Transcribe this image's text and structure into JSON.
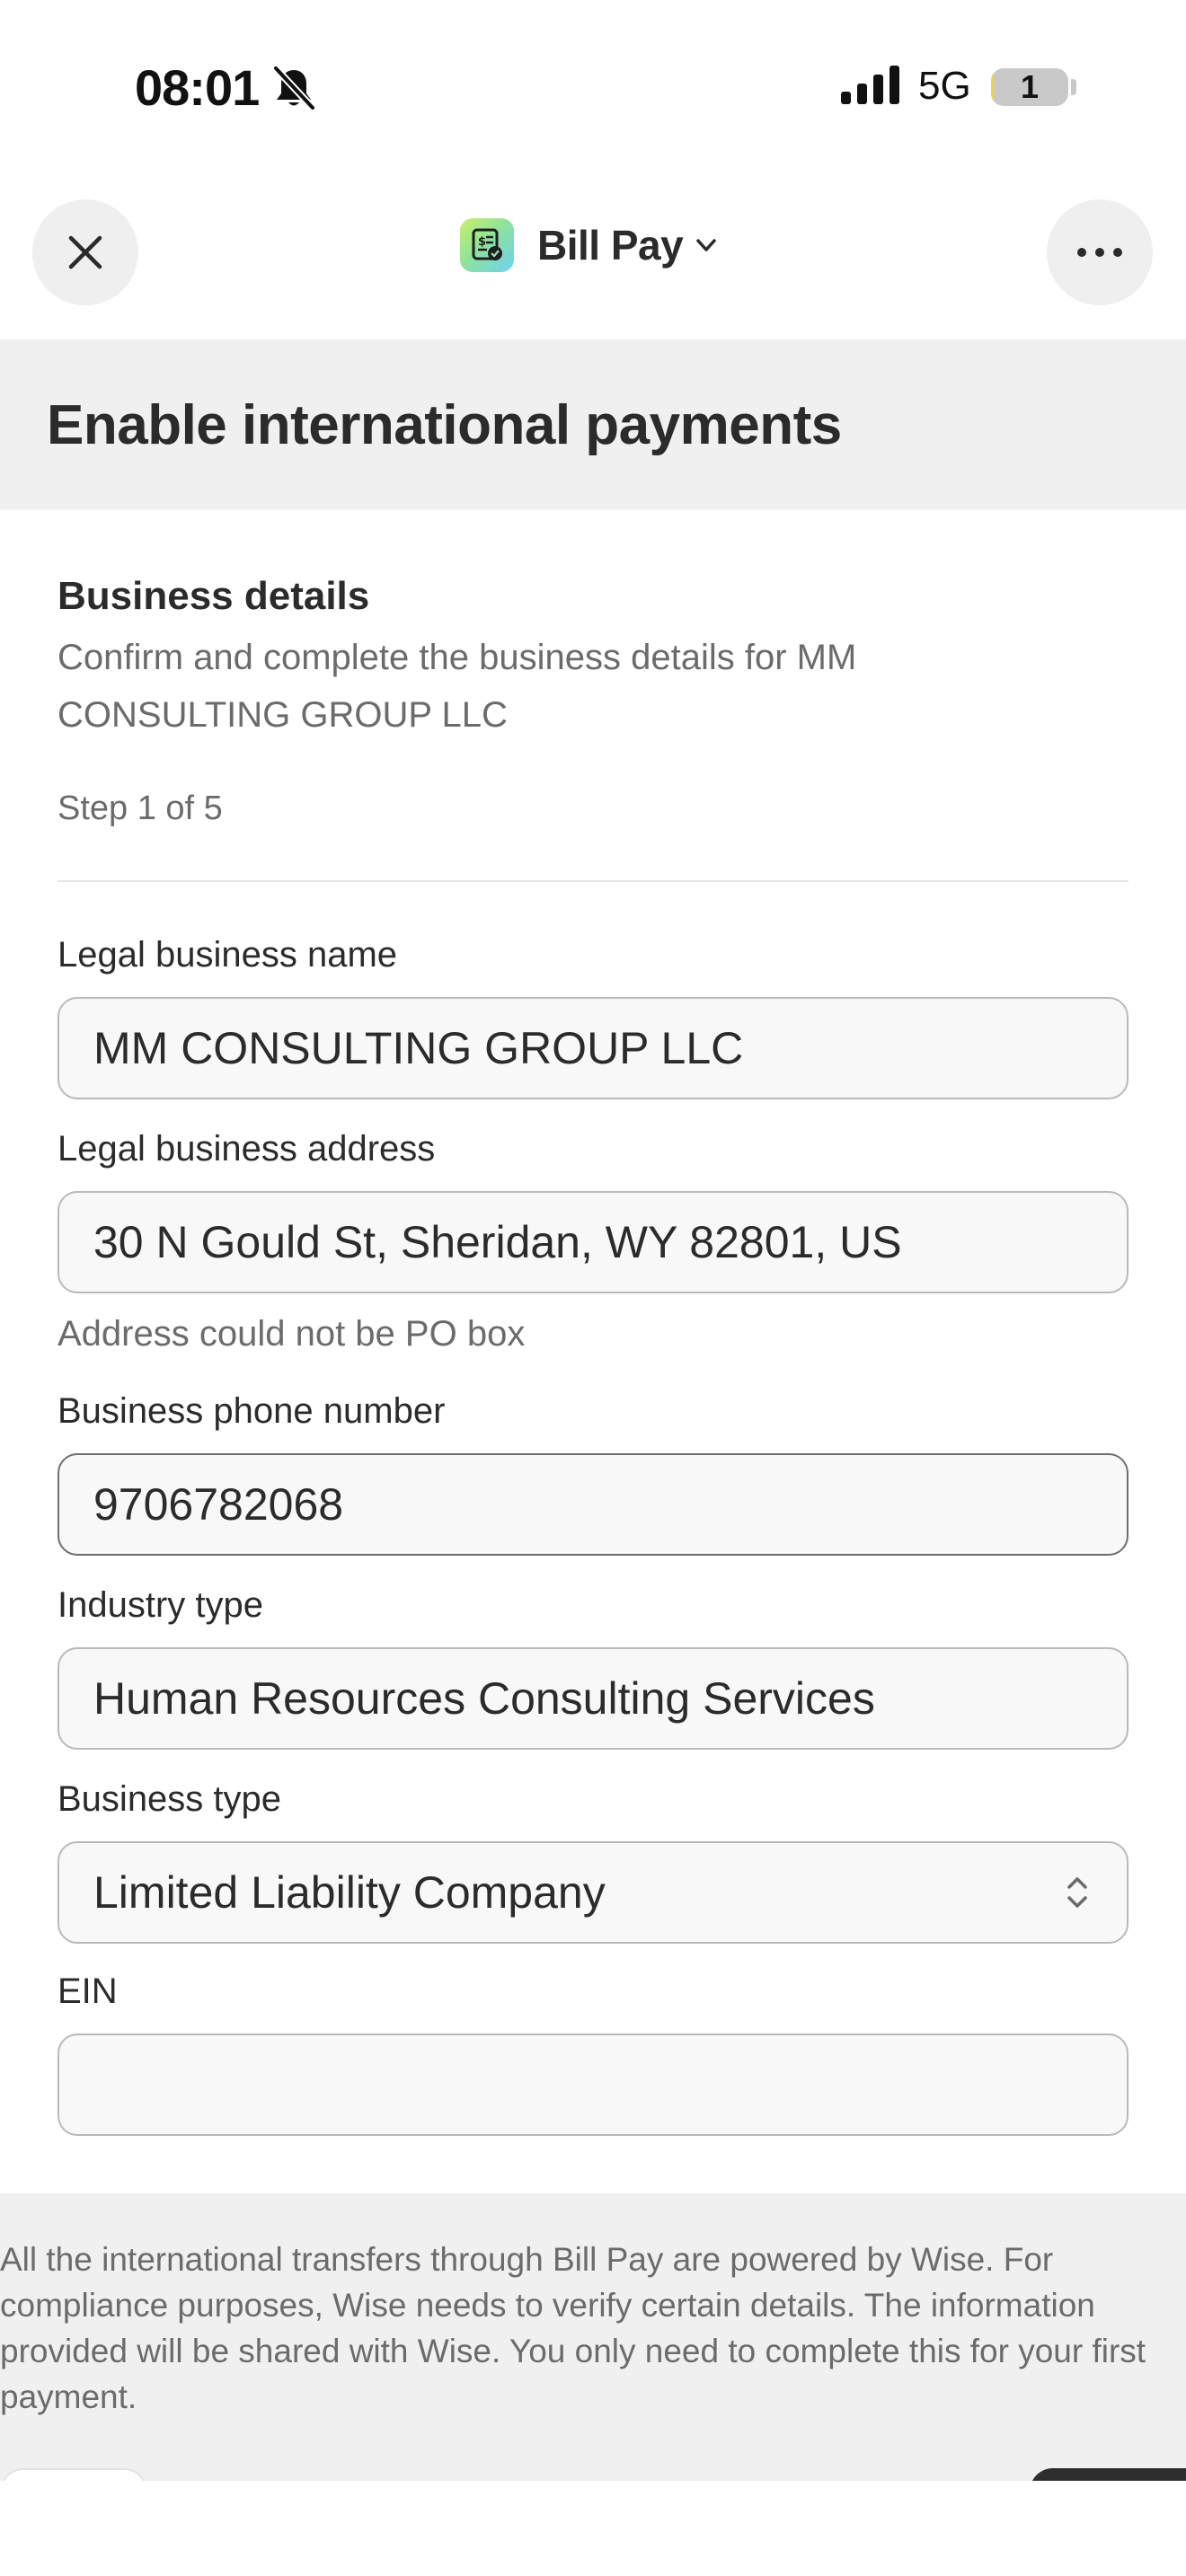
{
  "status_bar": {
    "time": "08:01",
    "network": "5G",
    "battery_level": "1",
    "battery_fraction": 0.04
  },
  "nav": {
    "app_title": "Bill Pay",
    "icons": {
      "close": "close-icon",
      "more": "more-horizontal-icon",
      "app": "bill-pay-icon",
      "dropdown": "chevron-down-icon"
    }
  },
  "page": {
    "title": "Enable international payments"
  },
  "section": {
    "heading": "Business details",
    "description": "Confirm and complete the business details for MM CONSULTING GROUP LLC",
    "step": "Step 1 of 5"
  },
  "form": {
    "legal_name": {
      "label": "Legal business name",
      "value": "MM CONSULTING GROUP LLC"
    },
    "address": {
      "label": "Legal business address",
      "value": "30 N Gould St, Sheridan, WY 82801, US",
      "helper": "Address could not be PO box"
    },
    "phone": {
      "label": "Business phone number",
      "value": "9706782068"
    },
    "industry": {
      "label": "Industry type",
      "value": "Human Resources Consulting Services"
    },
    "business_type": {
      "label": "Business type",
      "value": "Limited Liability Company"
    },
    "ein": {
      "label": "EIN",
      "value": ""
    }
  },
  "footer": {
    "note": "All the international transfers through Bill Pay are powered by Wise. For compliance purposes, Wise needs to verify certain details. The information provided will be shared with Wise. You only need to complete this for your first payment."
  },
  "colors": {
    "background": "#ffffff",
    "band": "#f0f0f0",
    "text": "#2b2b2b",
    "muted_text": "#6b6b6b",
    "field_border": "#b9b9b9",
    "field_border_focused": "#6e6e6e",
    "primary_button": "#2d2d2d",
    "battery_fill": "#f3d23b"
  }
}
